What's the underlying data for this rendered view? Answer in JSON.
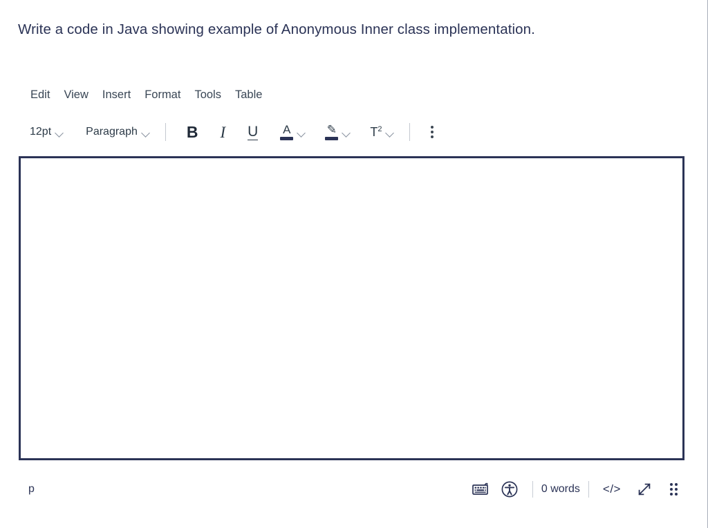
{
  "question": {
    "text": "Write a code in Java showing example of Anonymous Inner class implementation."
  },
  "menubar": {
    "items": [
      {
        "label": "Edit"
      },
      {
        "label": "View"
      },
      {
        "label": "Insert"
      },
      {
        "label": "Format"
      },
      {
        "label": "Tools"
      },
      {
        "label": "Table"
      }
    ]
  },
  "toolbar": {
    "fontsize": {
      "label": "12pt",
      "icon": "chevron-down-icon"
    },
    "blockformat": {
      "label": "Paragraph",
      "icon": "chevron-down-icon"
    },
    "bold": {
      "glyph": "B",
      "icon": "bold-icon"
    },
    "italic": {
      "glyph": "I",
      "icon": "italic-icon"
    },
    "underline": {
      "glyph": "U",
      "icon": "underline-icon"
    },
    "textcolor": {
      "glyph": "A",
      "icon": "text-color-icon",
      "swatch": "#2b3356"
    },
    "highlight": {
      "glyph": "✎",
      "icon": "highlight-color-icon",
      "swatch": "#2b3356"
    },
    "superscript": {
      "glyph": "T",
      "sup": "2",
      "icon": "superscript-icon"
    },
    "more": {
      "icon": "kebab-menu-icon"
    }
  },
  "editor": {
    "content": "",
    "border_color": "#2b3356"
  },
  "statusbar": {
    "elementpath": "p",
    "keyboard": {
      "icon": "keyboard-icon"
    },
    "accessibility": {
      "icon": "accessibility-check-icon"
    },
    "wordcount": "0 words",
    "sourcecode": {
      "label": "</>",
      "icon": "html-editor-icon"
    },
    "resize": {
      "icon": "resize-diagonal-icon"
    },
    "draghandle": {
      "icon": "drag-handle-icon"
    }
  },
  "colors": {
    "ink": "#2b3356",
    "menu_text": "#394655",
    "divider": "#c3c8d0",
    "page_edge": "#a7adb8"
  }
}
